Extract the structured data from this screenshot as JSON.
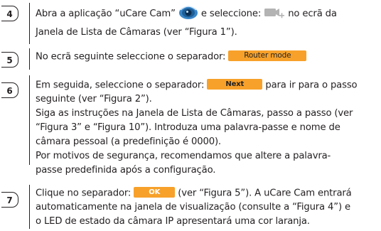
{
  "steps": [
    {
      "number": "4",
      "lines": [
        {
          "pre": "Abra a aplicação “uCare Cam” ",
          "icon": "ucare-cam-app-icon",
          "mid": " e seleccione: ",
          "icon2": "add-camera-icon",
          "post": " no ecrã da"
        },
        {
          "text": "Janela de Lista de Câmaras (ver “Figura 1”)."
        }
      ]
    },
    {
      "number": "5",
      "lines": [
        {
          "pre": "No ecrã seguinte seleccione o separador: ",
          "button": "Router mode"
        }
      ]
    },
    {
      "number": "6",
      "lines": [
        {
          "pre": "Em seguida, seleccione o separador: ",
          "button": "Next",
          "post": " para ir para o passo"
        },
        {
          "text": "seguinte (ver “Figura 2”)."
        },
        {
          "text": "Siga as instruções na Janela de Lista de Câmaras, passo a passo (ver"
        },
        {
          "text": "“Figura 3” e “Figura 10”). Introduza uma palavra-passe e nome de"
        },
        {
          "text": "câmara pessoal (a predefinição é 0000)."
        },
        {
          "text": "Por motivos de segurança, recomendamos que altere a palavra-"
        },
        {
          "text": "passe predefinida após a configuração."
        }
      ]
    },
    {
      "number": "7",
      "lines": [
        {
          "pre": "Clique no separador: ",
          "button": "OK",
          "post": " (ver “Figura 5”). A uCare Cam entrará"
        },
        {
          "text": "automaticamente na janela de visualização (consulte a “Figura 4”) e"
        },
        {
          "text": "o LED de estado da câmara IP apresentará uma cor laranja."
        }
      ]
    }
  ],
  "colors": {
    "button": "#f7a12a",
    "text": "#231f20"
  }
}
